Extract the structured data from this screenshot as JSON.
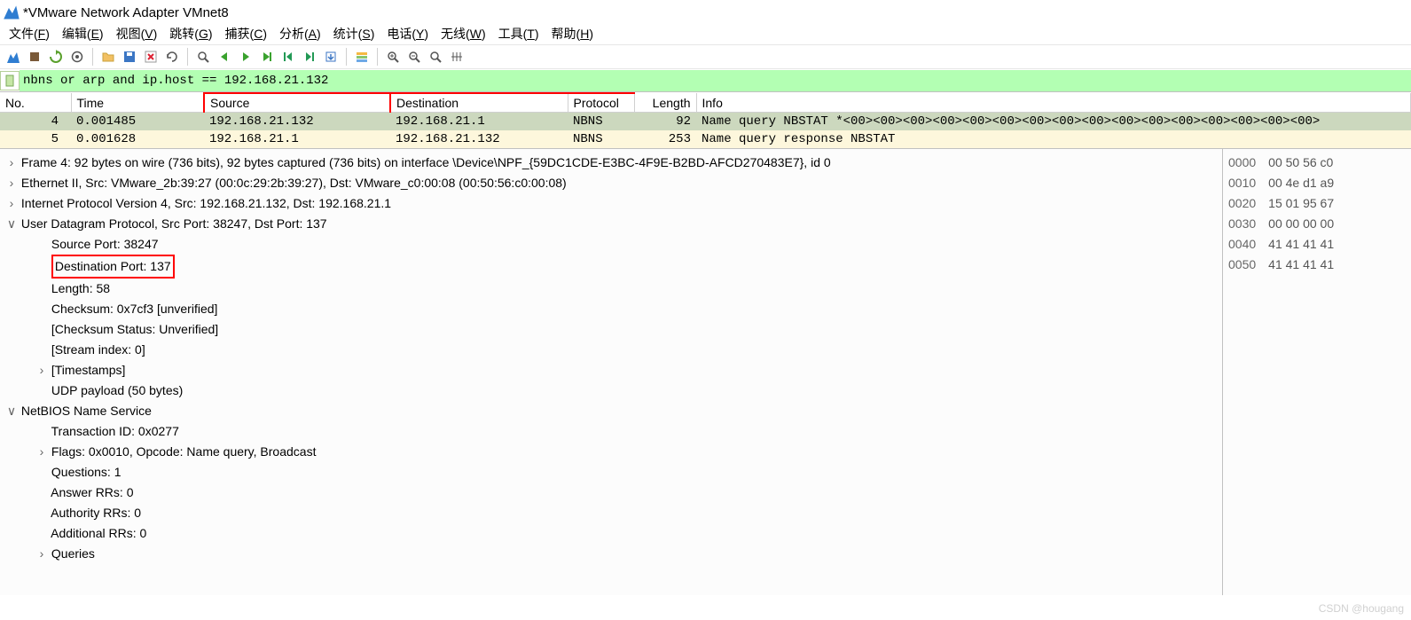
{
  "window": {
    "title": "*VMware Network Adapter VMnet8"
  },
  "menu": [
    "文件(F)",
    "编辑(E)",
    "视图(V)",
    "跳转(G)",
    "捕获(C)",
    "分析(A)",
    "统计(S)",
    "电话(Y)",
    "无线(W)",
    "工具(T)",
    "帮助(H)"
  ],
  "filter": {
    "value": "nbns or arp and ip.host == 192.168.21.132"
  },
  "columns": [
    "No.",
    "Time",
    "Source",
    "Destination",
    "Protocol",
    "Length",
    "Info"
  ],
  "packets": [
    {
      "no": "4",
      "time": "0.001485",
      "src": "192.168.21.132",
      "dst": "192.168.21.1",
      "proto": "NBNS",
      "len": "92",
      "info": "Name query NBSTAT *<00><00><00><00><00><00><00><00><00><00><00><00><00><00><00><00>",
      "cls": "pkt-green"
    },
    {
      "no": "5",
      "time": "0.001628",
      "src": "192.168.21.1",
      "dst": "192.168.21.132",
      "proto": "NBNS",
      "len": "253",
      "info": "Name query response NBSTAT",
      "cls": "pkt-yellow"
    }
  ],
  "details": [
    {
      "tw": ">",
      "ind": 0,
      "text": "Frame 4: 92 bytes on wire (736 bits), 92 bytes captured (736 bits) on interface \\Device\\NPF_{59DC1CDE-E3BC-4F9E-B2BD-AFCD270483E7}, id 0"
    },
    {
      "tw": ">",
      "ind": 0,
      "text": "Ethernet II, Src: VMware_2b:39:27 (00:0c:29:2b:39:27), Dst: VMware_c0:00:08 (00:50:56:c0:00:08)"
    },
    {
      "tw": ">",
      "ind": 0,
      "text": "Internet Protocol Version 4, Src: 192.168.21.132, Dst: 192.168.21.1"
    },
    {
      "tw": "v",
      "ind": 0,
      "text": "User Datagram Protocol, Src Port: 38247, Dst Port: 137"
    },
    {
      "tw": "",
      "ind": 1,
      "text": "Source Port: 38247"
    },
    {
      "tw": "",
      "ind": 1,
      "text": "Destination Port: 137",
      "red": true
    },
    {
      "tw": "",
      "ind": 1,
      "text": "Length: 58"
    },
    {
      "tw": "",
      "ind": 1,
      "text": "Checksum: 0x7cf3 [unverified]"
    },
    {
      "tw": "",
      "ind": 1,
      "text": "[Checksum Status: Unverified]"
    },
    {
      "tw": "",
      "ind": 1,
      "text": "[Stream index: 0]"
    },
    {
      "tw": ">",
      "ind": 1,
      "text": "[Timestamps]"
    },
    {
      "tw": "",
      "ind": 1,
      "text": "UDP payload (50 bytes)"
    },
    {
      "tw": "v",
      "ind": 0,
      "text": "NetBIOS Name Service"
    },
    {
      "tw": "",
      "ind": 1,
      "text": "Transaction ID: 0x0277"
    },
    {
      "tw": ">",
      "ind": 1,
      "text": "Flags: 0x0010, Opcode: Name query, Broadcast"
    },
    {
      "tw": "",
      "ind": 1,
      "text": "Questions: 1"
    },
    {
      "tw": "",
      "ind": 1,
      "text": "Answer RRs: 0"
    },
    {
      "tw": "",
      "ind": 1,
      "text": "Authority RRs: 0"
    },
    {
      "tw": "",
      "ind": 1,
      "text": "Additional RRs: 0"
    },
    {
      "tw": ">",
      "ind": 1,
      "text": "Queries"
    }
  ],
  "hex": [
    {
      "off": "0000",
      "b": "00 50 56 c0"
    },
    {
      "off": "0010",
      "b": "00 4e d1 a9"
    },
    {
      "off": "0020",
      "b": "15 01 95 67"
    },
    {
      "off": "0030",
      "b": "00 00 00 00"
    },
    {
      "off": "0040",
      "b": "41 41 41 41"
    },
    {
      "off": "0050",
      "b": "41 41 41 41"
    }
  ],
  "watermark": "CSDN @hougang"
}
